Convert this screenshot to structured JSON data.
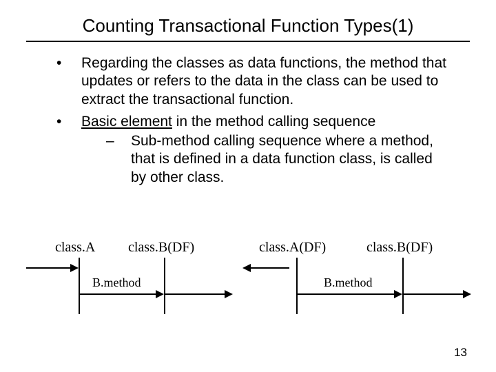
{
  "title": "Counting Transactional Function Types(1)",
  "bullets": {
    "item1": "Regarding the classes as data functions, the method that updates or refers to the data in the class can be used to extract the transactional function.",
    "item2_lead": "Basic element",
    "item2_rest": " in the method calling sequence",
    "sub1": "Sub-method calling sequence where a method, that is defined in a data function class, is called by other class."
  },
  "diagram": {
    "classA": "class.A",
    "classBDF1": "class.B(DF)",
    "classADF": "class.A(DF)",
    "classBDF2": "class.B(DF)",
    "b_method_left": "B.method",
    "b_method_right": "B.method"
  },
  "page_number": "13"
}
